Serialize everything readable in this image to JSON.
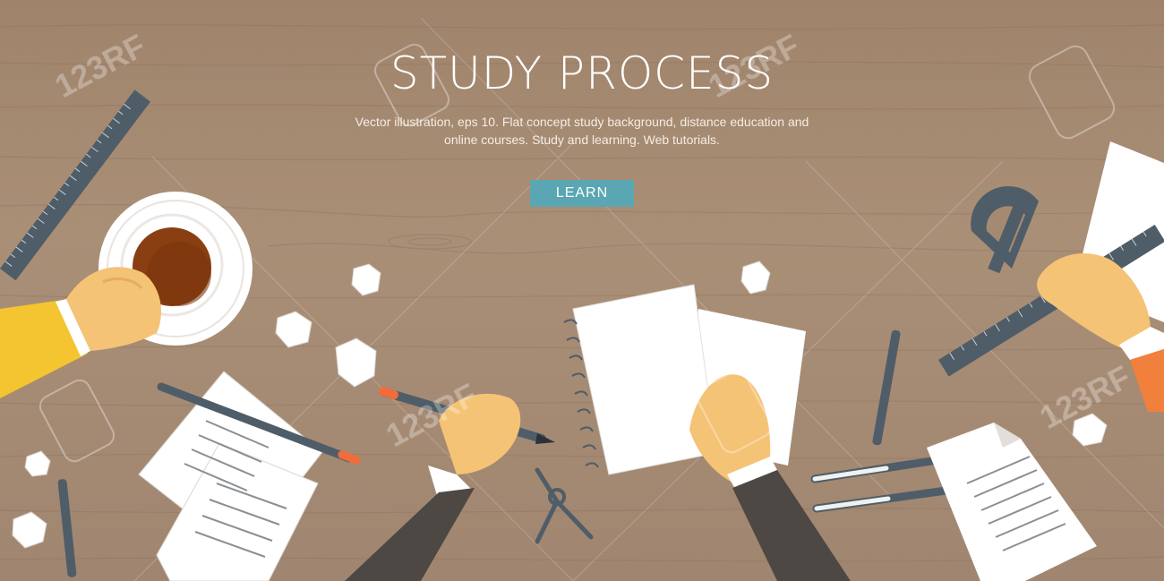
{
  "banner": {
    "title": "STUDY PROCESS",
    "subtitle_line1": "Vector illustration, eps 10. Flat concept study background, distance education and",
    "subtitle_line2": "online courses. Study and learning. Web tutorials.",
    "learn_label": "LEARN"
  },
  "watermark": {
    "text": "123RF"
  },
  "colors": {
    "wood": "#a58a72",
    "wood_dark": "#8e7560",
    "button": "#5aa6b2",
    "sleeve_yellow": "#f4c531",
    "sleeve_orange": "#f0803c",
    "sleeve_dark": "#4d4844",
    "skin": "#f5c376",
    "paper": "#ffffff",
    "coffee": "#8a3f12",
    "ruler": "#4f5d68"
  },
  "icons": [
    "coffee-cup-icon",
    "ruler-icon",
    "protractor-icon",
    "pencil-icon",
    "pen-icon",
    "compass-icon",
    "notebook-icon",
    "document-icon"
  ]
}
